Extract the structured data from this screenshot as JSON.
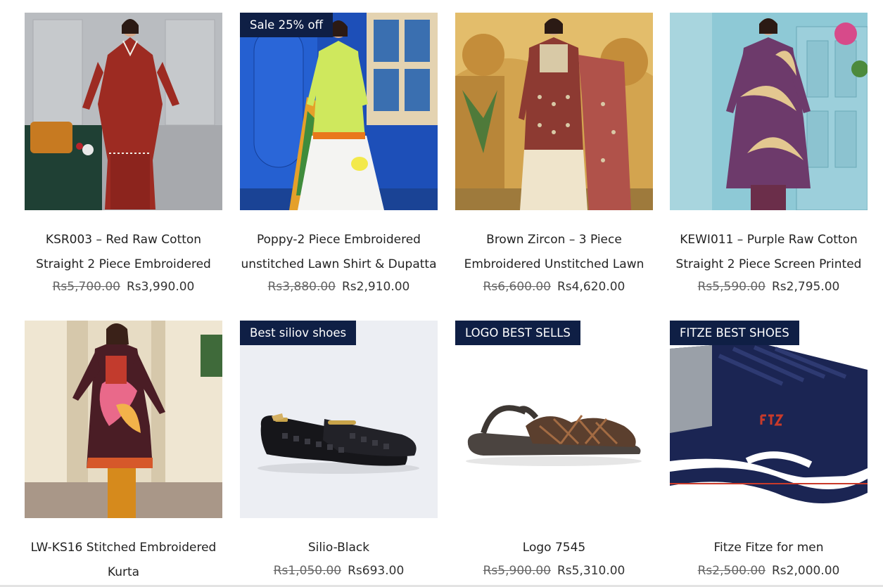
{
  "products": [
    {
      "title": "KSR003 – Red Raw Cotton Straight 2 Piece Embroidered",
      "old_price": "Rs5,700.00",
      "new_price": "Rs3,990.00",
      "badge": ""
    },
    {
      "title": "Poppy-2 Piece Embroidered unstitched Lawn Shirt & Dupatta",
      "old_price": "Rs3,880.00",
      "new_price": "Rs2,910.00",
      "badge": "Sale 25% off"
    },
    {
      "title": "Brown Zircon – 3 Piece Embroidered Unstitched Lawn",
      "old_price": "Rs6,600.00",
      "new_price": "Rs4,620.00",
      "badge": ""
    },
    {
      "title": "KEWI011 – Purple Raw Cotton Straight 2 Piece Screen Printed",
      "old_price": "Rs5,590.00",
      "new_price": "Rs2,795.00",
      "badge": ""
    },
    {
      "title": "LW-KS16 Stitched Embroidered Kurta",
      "old_price": "",
      "new_price": "",
      "badge": ""
    },
    {
      "title": "Silio-Black",
      "old_price": "Rs1,050.00",
      "new_price": "Rs693.00",
      "badge": "Best siliov shoes"
    },
    {
      "title": "Logo 7545",
      "old_price": "Rs5,900.00",
      "new_price": "Rs5,310.00",
      "badge": "LOGO BEST SELLS"
    },
    {
      "title": "Fitze Fitze for men",
      "old_price": "Rs2,500.00",
      "new_price": "Rs2,000.00",
      "badge": "FITZE BEST SHOES"
    }
  ],
  "colors": {
    "badge_bg": "#0f1f45",
    "price_old": "#666666",
    "price_new": "#333333"
  }
}
